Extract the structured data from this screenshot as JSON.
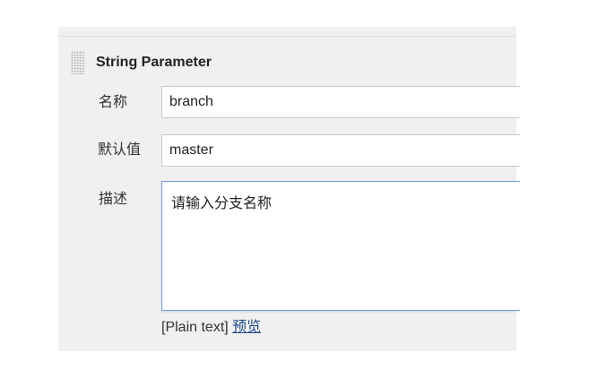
{
  "param": {
    "type_title": "String Parameter",
    "name_label": "名称",
    "name_value": "branch",
    "default_label": "默认值",
    "default_value": "master",
    "desc_label": "描述",
    "desc_value": "请输入分支名称",
    "plain_text_label": "[Plain text]",
    "preview_label": "预览"
  },
  "colors": {
    "panel_bg": "#f0f0f0",
    "link": "#204a87",
    "focus_border": "#6e9bd6"
  }
}
